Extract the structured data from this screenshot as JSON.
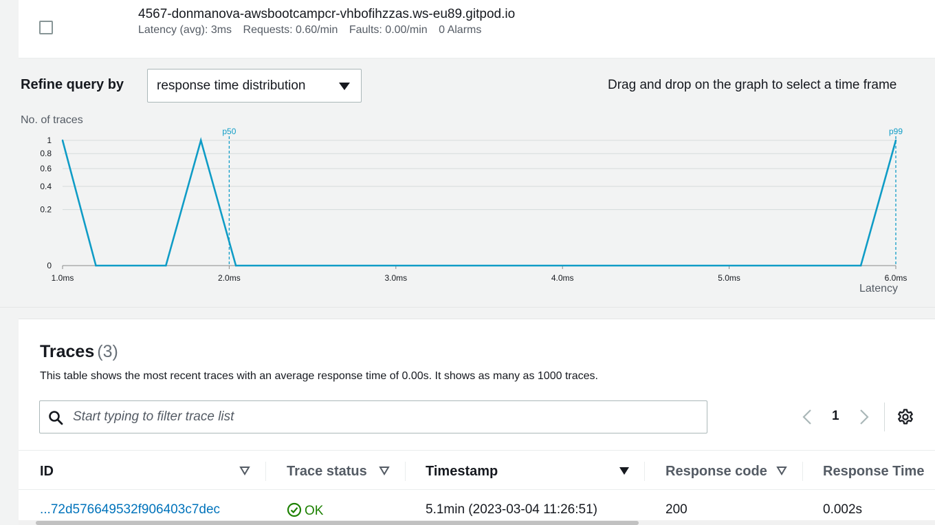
{
  "service": {
    "name": "4567-donmanova-awsbootcampcr-vhbofihzzas.ws-eu89.gitpod.io",
    "latency": "Latency (avg): 3ms",
    "requests": "Requests: 0.60/min",
    "faults": "Faults: 0.00/min",
    "alarms": "0 Alarms"
  },
  "refine": {
    "label": "Refine query by",
    "selected": "response time distribution",
    "hint": "Drag and drop on the graph to select a time frame"
  },
  "chart_data": {
    "type": "line",
    "ylabel": "No. of traces",
    "xlabel": "Latency",
    "x_ticks": [
      "1.0ms",
      "2.0ms",
      "3.0ms",
      "4.0ms",
      "5.0ms",
      "6.0ms"
    ],
    "y_ticks": [
      "0",
      "0.2",
      "0.4",
      "0.6",
      "0.8",
      "1"
    ],
    "xlim": [
      1.0,
      6.0
    ],
    "ylim": [
      0,
      1
    ],
    "y_scale": "sqrt",
    "grid": true,
    "series": [
      {
        "x": [
          1.0,
          1.2,
          1.62,
          1.83,
          2.04,
          5.79,
          6.0
        ],
        "y": [
          1,
          0,
          0,
          1,
          0,
          0,
          1
        ]
      }
    ],
    "markers": [
      {
        "label": "p50",
        "x": 2.0
      },
      {
        "label": "p99",
        "x": 6.0
      }
    ],
    "color": "#0f9cc6"
  },
  "traces": {
    "title": "Traces",
    "count": "(3)",
    "description": "This table shows the most recent traces with an average response time of 0.00s. It shows as many as 1000 traces.",
    "search_placeholder": "Start typing to filter trace list",
    "page": "1",
    "columns": {
      "id": "ID",
      "status": "Trace status",
      "timestamp": "Timestamp",
      "code": "Response code",
      "time": "Response Time"
    },
    "rows": [
      {
        "id": "...72d576649532f906403c7dec",
        "status": "OK",
        "timestamp": "5.1min (2023-03-04 11:26:51)",
        "code": "200",
        "time": "0.002s"
      }
    ]
  },
  "icons": {
    "search": "search-icon",
    "prev": "chevron-left-icon",
    "next": "chevron-right-icon",
    "settings": "gear-icon",
    "ok": "check-circle-icon"
  },
  "colors": {
    "accent_link": "#0073bb",
    "chart_line": "#0f9cc6",
    "status_ok": "#1d8102"
  }
}
